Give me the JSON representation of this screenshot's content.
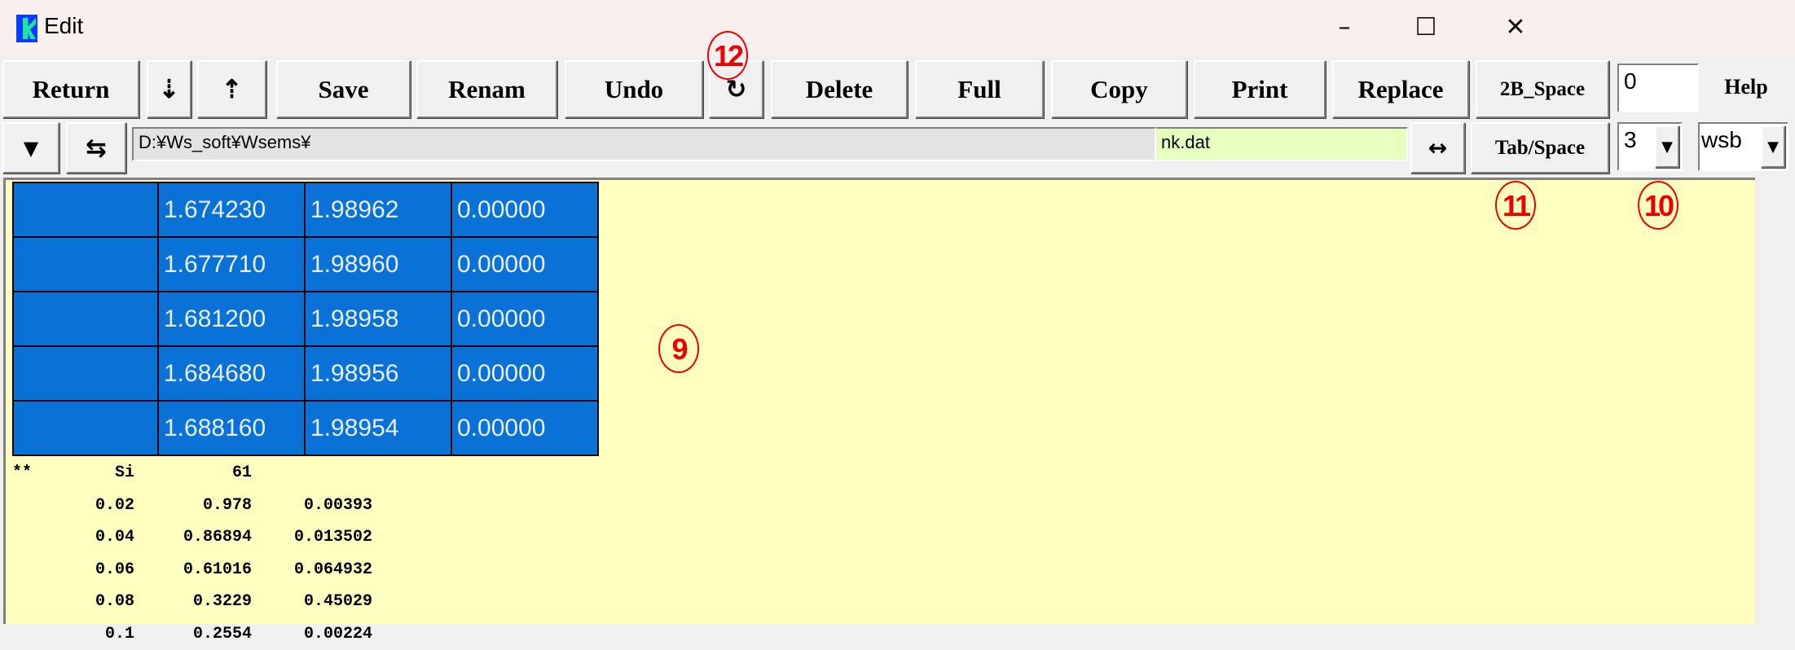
{
  "window": {
    "title": "Edit",
    "controls": [
      "–",
      "☐",
      "✕"
    ]
  },
  "toolbar": {
    "return": "Return",
    "down": "⇣",
    "up": "⇡",
    "save": "Save",
    "rename": "Renam",
    "undo": "Undo",
    "redo": "↻",
    "delete": "Delete",
    "full": "Full",
    "copy": "Copy",
    "print": "Print",
    "replace": "Replace",
    "space2b": "2B_Space",
    "number_value": "0",
    "help": "Help"
  },
  "row2": {
    "dropdown": "▼",
    "swap": "⇆",
    "path": "D:¥Ws_soft¥Wsems¥",
    "filename": "nk.dat",
    "expand": "↔",
    "tabspace": "Tab/Space",
    "tab_select": "3",
    "encoding_select": "wsb",
    "arrow": "▼"
  },
  "annotations": {
    "a9": "9",
    "a10": "10",
    "a11": "11",
    "a12": "12"
  },
  "selected_table": [
    [
      "",
      "1.674230",
      "1.98962",
      "0.00000"
    ],
    [
      "",
      "1.677710",
      "1.98960",
      "0.00000"
    ],
    [
      "",
      "1.681200",
      "1.98958",
      "0.00000"
    ],
    [
      "",
      "1.684680",
      "1.98956",
      "0.00000"
    ],
    [
      "",
      "1.688160",
      "1.98954",
      "0.00000"
    ]
  ],
  "text_lines": [
    [
      "**",
      "Si",
      "61",
      ""
    ],
    [
      "",
      "0.02",
      "0.978",
      "0.00393"
    ],
    [
      "",
      "0.04",
      "0.86894",
      "0.013502"
    ],
    [
      "",
      "0.06",
      "0.61016",
      "0.064932"
    ],
    [
      "",
      "0.08",
      "0.3229",
      "0.45029"
    ],
    [
      "",
      "0.1",
      "0.2554",
      "0.00224"
    ]
  ],
  "colors": {
    "editor_bg": "#ffffc0",
    "selection": "#0a72d6",
    "filename_bg": "#e6ffc0",
    "annotation": "#e00000"
  }
}
